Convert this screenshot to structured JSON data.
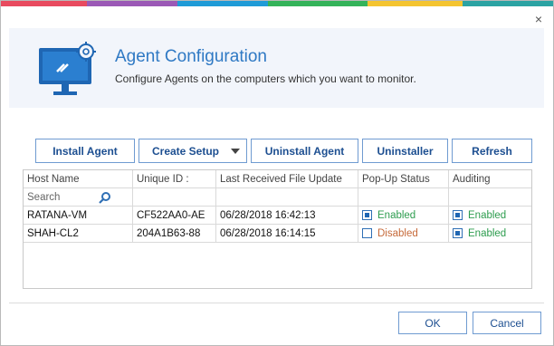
{
  "colors": {
    "stripe": [
      "#e84a5f",
      "#9b59b6",
      "#1f9bd7",
      "#34b35a",
      "#2a8fd0",
      "#f4c430",
      "#2ba3a3"
    ],
    "accent": "#2f79c4",
    "enabled": "#2e9d4f",
    "disabled": "#c66a3a"
  },
  "header": {
    "icon": "monitor-gear-icon",
    "title": "Agent Configuration",
    "subtitle": "Configure Agents on the computers which you want to monitor."
  },
  "toolbar": {
    "install": "Install Agent",
    "create_setup": "Create Setup",
    "uninstall": "Uninstall Agent",
    "uninstaller": "Uninstaller",
    "refresh": "Refresh"
  },
  "grid": {
    "columns": [
      "Host Name",
      "Unique ID :",
      "Last Received File Update",
      "Pop-Up Status",
      "Auditing"
    ],
    "search_placeholder": "Search",
    "rows": [
      {
        "host": "RATANA-VM",
        "uid": "CF522AA0-AE",
        "last": "06/28/2018 16:42:13",
        "popup_checked": true,
        "popup": "Enabled",
        "audit_checked": true,
        "audit": "Enabled"
      },
      {
        "host": "SHAH-CL2",
        "uid": "204A1B63-88",
        "last": "06/28/2018 16:14:15",
        "popup_checked": false,
        "popup": "Disabled",
        "audit_checked": true,
        "audit": "Enabled"
      }
    ]
  },
  "footer": {
    "ok": "OK",
    "cancel": "Cancel"
  },
  "close_glyph": "×"
}
